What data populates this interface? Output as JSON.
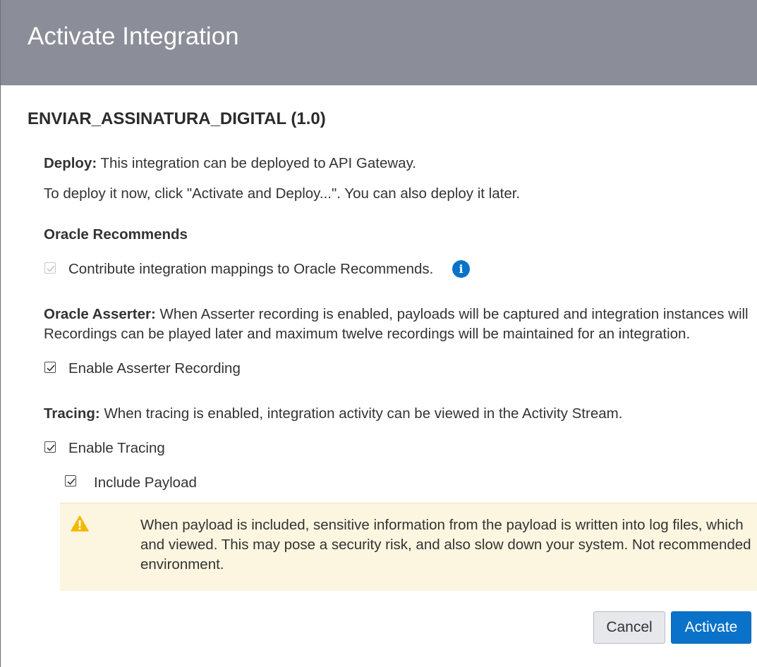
{
  "dialog": {
    "title": "Activate Integration",
    "integration_name": "ENVIAR_ASSINATURA_DIGITAL (1.0)"
  },
  "deploy": {
    "label": "Deploy:",
    "text": " This integration can be deployed to API Gateway.",
    "instruction": "To deploy it now, click \"Activate and Deploy...\". You can also deploy it later."
  },
  "recommends": {
    "heading": "Oracle Recommends",
    "checkbox_label": "Contribute integration mappings to Oracle Recommends.",
    "checked": true,
    "disabled": true,
    "info_icon_glyph": "i"
  },
  "asserter": {
    "label": "Oracle Asserter:",
    "text_line1": " When Asserter recording is enabled, payloads will be captured and integration instances will",
    "text_line2": "Recordings can be played later and maximum twelve recordings will be maintained for an integration.",
    "checkbox_label": "Enable Asserter Recording",
    "checked": true
  },
  "tracing": {
    "label": "Tracing:",
    "text": " When tracing is enabled, integration activity can be viewed in the Activity Stream.",
    "checkbox_label": "Enable Tracing",
    "checked": true,
    "payload_label": "Include Payload",
    "payload_checked": true
  },
  "warning": {
    "line1": "When payload is included, sensitive information from the payload is written into log files, which",
    "line2": "and viewed. This may pose a security risk, and also slow down your system. Not recommended",
    "line3": "environment."
  },
  "buttons": {
    "cancel": "Cancel",
    "activate": "Activate"
  },
  "colors": {
    "header_bg": "#8b8e98",
    "primary": "#0b72c9",
    "warning_bg": "#fcf6e0",
    "warning_icon": "#f5b800"
  }
}
